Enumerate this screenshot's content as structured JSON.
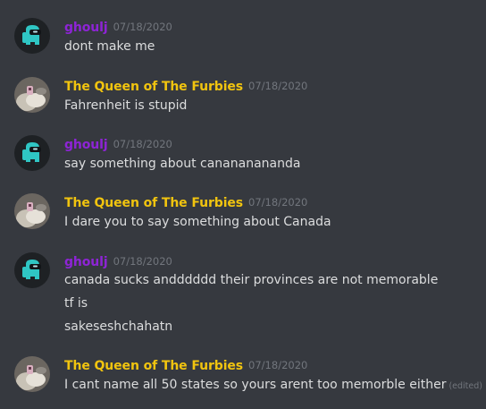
{
  "colors": {
    "background": "#36393f",
    "ghoulj": "#8e24d6",
    "queen": "#f1c40f",
    "message_text": "#dcddde",
    "timestamp": "#72767d"
  },
  "messages": [
    {
      "author": "ghoulj",
      "author_color": "#8e24d6",
      "avatar_icon": "among-us-cyan-crewmate-icon",
      "timestamp": "07/18/2020",
      "lines": [
        "dont make me"
      ]
    },
    {
      "author": "The Queen of The Furbies",
      "author_color": "#f1c40f",
      "avatar_icon": "furby-photo-icon",
      "timestamp": "07/18/2020",
      "lines": [
        "Fahrenheit is stupid"
      ]
    },
    {
      "author": "ghoulj",
      "author_color": "#8e24d6",
      "avatar_icon": "among-us-cyan-crewmate-icon",
      "timestamp": "07/18/2020",
      "lines": [
        "say something about canananananda"
      ]
    },
    {
      "author": "The Queen of The Furbies",
      "author_color": "#f1c40f",
      "avatar_icon": "furby-photo-icon",
      "timestamp": "07/18/2020",
      "lines": [
        "I dare you to say something about Canada"
      ]
    },
    {
      "author": "ghoulj",
      "author_color": "#8e24d6",
      "avatar_icon": "among-us-cyan-crewmate-icon",
      "timestamp": "07/18/2020",
      "lines": [
        "canada sucks andddddd their provinces are not memorable",
        "tf is",
        "sakeseshchahatn"
      ]
    },
    {
      "author": "The Queen of The Furbies",
      "author_color": "#f1c40f",
      "avatar_icon": "furby-photo-icon",
      "timestamp": "07/18/2020",
      "lines": [
        "I cant name all 50 states so yours arent too memorble either"
      ],
      "edited_label": "(edited)"
    }
  ]
}
